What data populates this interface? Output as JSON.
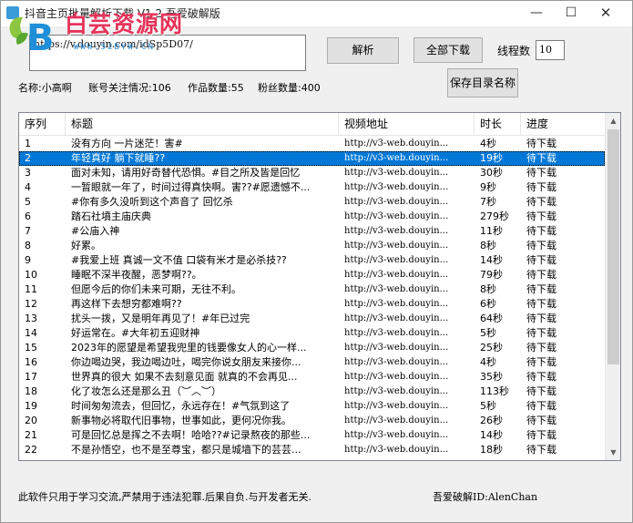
{
  "window": {
    "title": "抖音主页批量解析下载 V1.2 吾爱破解版",
    "minimize_glyph": "—",
    "maximize_glyph": "☐",
    "close_glyph": "✕"
  },
  "watermark": {
    "main": "白芸资源网",
    "url": "WWW.52BYW.CN"
  },
  "url_input": {
    "value": "https://v.douyin.com/idSp5D07/"
  },
  "buttons": {
    "parse": "解析",
    "download_all": "全部下载",
    "save_dir_names": "保存目录名称"
  },
  "threads": {
    "label": "线程数",
    "value": "10"
  },
  "user_info": {
    "name": "名称:小高啊",
    "follow": "账号关注情况:106",
    "works": "作品数量:55",
    "fans": "粉丝数量:400"
  },
  "list": {
    "columns": [
      "序列",
      "标题",
      "视频地址",
      "时长",
      "进度"
    ],
    "selected_index": 1,
    "rows": [
      [
        "1",
        "没有方向 一片迷茫！害#",
        "http://v3-web.douyin...",
        "4秒",
        "待下载"
      ],
      [
        "2",
        "年轻真好 躺下就睡??",
        "http://v3-web.douyin...",
        "19秒",
        "待下载"
      ],
      [
        "3",
        "面对未知，请用好奇替代恐惧。#目之所及皆是回忆",
        "http://v3-web.douyin...",
        "30秒",
        "待下载"
      ],
      [
        "4",
        "一暂眼就一年了，时间过得真快啊。害??#愿遗憾不...",
        "http://v3-web.douyin...",
        "9秒",
        "待下载"
      ],
      [
        "5",
        "#你有多久没听到这个声音了 回忆杀",
        "http://v3-web.douyin...",
        "7秒",
        "待下载"
      ],
      [
        "6",
        "踏石社墳主庙庆典",
        "http://v3-web.douyin...",
        "279秒",
        "待下载"
      ],
      [
        "7",
        "#公庙入神",
        "http://v3-web.douyin...",
        "11秒",
        "待下载"
      ],
      [
        "8",
        "好累。",
        "http://v3-web.douyin...",
        "8秒",
        "待下载"
      ],
      [
        "9",
        "#我爱上班 真诚一文不值 口袋有米才是必杀技??",
        "http://v3-web.douyin...",
        "14秒",
        "待下载"
      ],
      [
        "10",
        "睡眠不深半夜醒，恶梦啊??。",
        "http://v3-web.douyin...",
        "79秒",
        "待下载"
      ],
      [
        "11",
        "但愿今后的你们未来可期，无往不利。",
        "http://v3-web.douyin...",
        "8秒",
        "待下载"
      ],
      [
        "12",
        "再这样下去想穷都难啊??",
        "http://v3-web.douyin...",
        "6秒",
        "待下载"
      ],
      [
        "13",
        "扰头一拨，又是明年再见了！#年已过完",
        "http://v3-web.douyin...",
        "64秒",
        "待下载"
      ],
      [
        "14",
        "好运常在。#大年初五迎财神",
        "http://v3-web.douyin...",
        "5秒",
        "待下载"
      ],
      [
        "15",
        "2023年的愿望是希望我兜里的钱要像女人的心一样...",
        "http://v3-web.douyin...",
        "25秒",
        "待下载"
      ],
      [
        "16",
        "你边喝边哭，我边喝边吐，喝完你说女朋友来接你...",
        "http://v3-web.douyin...",
        "4秒",
        "待下载"
      ],
      [
        "17",
        "世界真的很大 如果不去刻意见面 就真的不会再见...",
        "http://v3-web.douyin...",
        "35秒",
        "待下载"
      ],
      [
        "18",
        "化了妆怎么还是那么丑（︶︿︶）",
        "http://v3-web.douyin...",
        "113秒",
        "待下载"
      ],
      [
        "19",
        "时间匆匆流去，但回忆，永远存在！#气氛到这了",
        "http://v3-web.douyin...",
        "5秒",
        "待下载"
      ],
      [
        "20",
        "新事物必将取代旧事物，世事如此，更何况你我。",
        "http://v3-web.douyin...",
        "26秒",
        "待下载"
      ],
      [
        "21",
        "可是回忆总是挥之不去啊！哈哈??#记录熬夜的那些...",
        "http://v3-web.douyin...",
        "14秒",
        "待下载"
      ],
      [
        "22",
        "不是孙悟空，也不是至尊宝，都只是城墙下的芸芸...",
        "http://v3-web.douyin...",
        "18秒",
        "待下载"
      ]
    ]
  },
  "footer": {
    "disclaimer": "此软件只用于学习交流,严禁用于违法犯罪.后果自负.与开发者无关.",
    "credit": "吾爱破解ID:AlenChan"
  }
}
